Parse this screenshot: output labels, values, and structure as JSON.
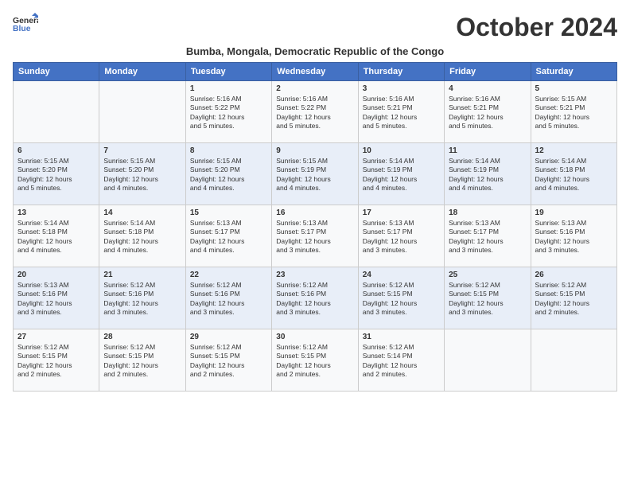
{
  "logo": {
    "text_line1": "General",
    "text_line2": "Blue"
  },
  "title": "October 2024",
  "subtitle": "Bumba, Mongala, Democratic Republic of the Congo",
  "days_of_week": [
    "Sunday",
    "Monday",
    "Tuesday",
    "Wednesday",
    "Thursday",
    "Friday",
    "Saturday"
  ],
  "weeks": [
    [
      {
        "day": "",
        "info": ""
      },
      {
        "day": "",
        "info": ""
      },
      {
        "day": "1",
        "info": "Sunrise: 5:16 AM\nSunset: 5:22 PM\nDaylight: 12 hours\nand 5 minutes."
      },
      {
        "day": "2",
        "info": "Sunrise: 5:16 AM\nSunset: 5:22 PM\nDaylight: 12 hours\nand 5 minutes."
      },
      {
        "day": "3",
        "info": "Sunrise: 5:16 AM\nSunset: 5:21 PM\nDaylight: 12 hours\nand 5 minutes."
      },
      {
        "day": "4",
        "info": "Sunrise: 5:16 AM\nSunset: 5:21 PM\nDaylight: 12 hours\nand 5 minutes."
      },
      {
        "day": "5",
        "info": "Sunrise: 5:15 AM\nSunset: 5:21 PM\nDaylight: 12 hours\nand 5 minutes."
      }
    ],
    [
      {
        "day": "6",
        "info": "Sunrise: 5:15 AM\nSunset: 5:20 PM\nDaylight: 12 hours\nand 5 minutes."
      },
      {
        "day": "7",
        "info": "Sunrise: 5:15 AM\nSunset: 5:20 PM\nDaylight: 12 hours\nand 4 minutes."
      },
      {
        "day": "8",
        "info": "Sunrise: 5:15 AM\nSunset: 5:20 PM\nDaylight: 12 hours\nand 4 minutes."
      },
      {
        "day": "9",
        "info": "Sunrise: 5:15 AM\nSunset: 5:19 PM\nDaylight: 12 hours\nand 4 minutes."
      },
      {
        "day": "10",
        "info": "Sunrise: 5:14 AM\nSunset: 5:19 PM\nDaylight: 12 hours\nand 4 minutes."
      },
      {
        "day": "11",
        "info": "Sunrise: 5:14 AM\nSunset: 5:19 PM\nDaylight: 12 hours\nand 4 minutes."
      },
      {
        "day": "12",
        "info": "Sunrise: 5:14 AM\nSunset: 5:18 PM\nDaylight: 12 hours\nand 4 minutes."
      }
    ],
    [
      {
        "day": "13",
        "info": "Sunrise: 5:14 AM\nSunset: 5:18 PM\nDaylight: 12 hours\nand 4 minutes."
      },
      {
        "day": "14",
        "info": "Sunrise: 5:14 AM\nSunset: 5:18 PM\nDaylight: 12 hours\nand 4 minutes."
      },
      {
        "day": "15",
        "info": "Sunrise: 5:13 AM\nSunset: 5:17 PM\nDaylight: 12 hours\nand 4 minutes."
      },
      {
        "day": "16",
        "info": "Sunrise: 5:13 AM\nSunset: 5:17 PM\nDaylight: 12 hours\nand 3 minutes."
      },
      {
        "day": "17",
        "info": "Sunrise: 5:13 AM\nSunset: 5:17 PM\nDaylight: 12 hours\nand 3 minutes."
      },
      {
        "day": "18",
        "info": "Sunrise: 5:13 AM\nSunset: 5:17 PM\nDaylight: 12 hours\nand 3 minutes."
      },
      {
        "day": "19",
        "info": "Sunrise: 5:13 AM\nSunset: 5:16 PM\nDaylight: 12 hours\nand 3 minutes."
      }
    ],
    [
      {
        "day": "20",
        "info": "Sunrise: 5:13 AM\nSunset: 5:16 PM\nDaylight: 12 hours\nand 3 minutes."
      },
      {
        "day": "21",
        "info": "Sunrise: 5:12 AM\nSunset: 5:16 PM\nDaylight: 12 hours\nand 3 minutes."
      },
      {
        "day": "22",
        "info": "Sunrise: 5:12 AM\nSunset: 5:16 PM\nDaylight: 12 hours\nand 3 minutes."
      },
      {
        "day": "23",
        "info": "Sunrise: 5:12 AM\nSunset: 5:16 PM\nDaylight: 12 hours\nand 3 minutes."
      },
      {
        "day": "24",
        "info": "Sunrise: 5:12 AM\nSunset: 5:15 PM\nDaylight: 12 hours\nand 3 minutes."
      },
      {
        "day": "25",
        "info": "Sunrise: 5:12 AM\nSunset: 5:15 PM\nDaylight: 12 hours\nand 3 minutes."
      },
      {
        "day": "26",
        "info": "Sunrise: 5:12 AM\nSunset: 5:15 PM\nDaylight: 12 hours\nand 2 minutes."
      }
    ],
    [
      {
        "day": "27",
        "info": "Sunrise: 5:12 AM\nSunset: 5:15 PM\nDaylight: 12 hours\nand 2 minutes."
      },
      {
        "day": "28",
        "info": "Sunrise: 5:12 AM\nSunset: 5:15 PM\nDaylight: 12 hours\nand 2 minutes."
      },
      {
        "day": "29",
        "info": "Sunrise: 5:12 AM\nSunset: 5:15 PM\nDaylight: 12 hours\nand 2 minutes."
      },
      {
        "day": "30",
        "info": "Sunrise: 5:12 AM\nSunset: 5:15 PM\nDaylight: 12 hours\nand 2 minutes."
      },
      {
        "day": "31",
        "info": "Sunrise: 5:12 AM\nSunset: 5:14 PM\nDaylight: 12 hours\nand 2 minutes."
      },
      {
        "day": "",
        "info": ""
      },
      {
        "day": "",
        "info": ""
      }
    ]
  ]
}
